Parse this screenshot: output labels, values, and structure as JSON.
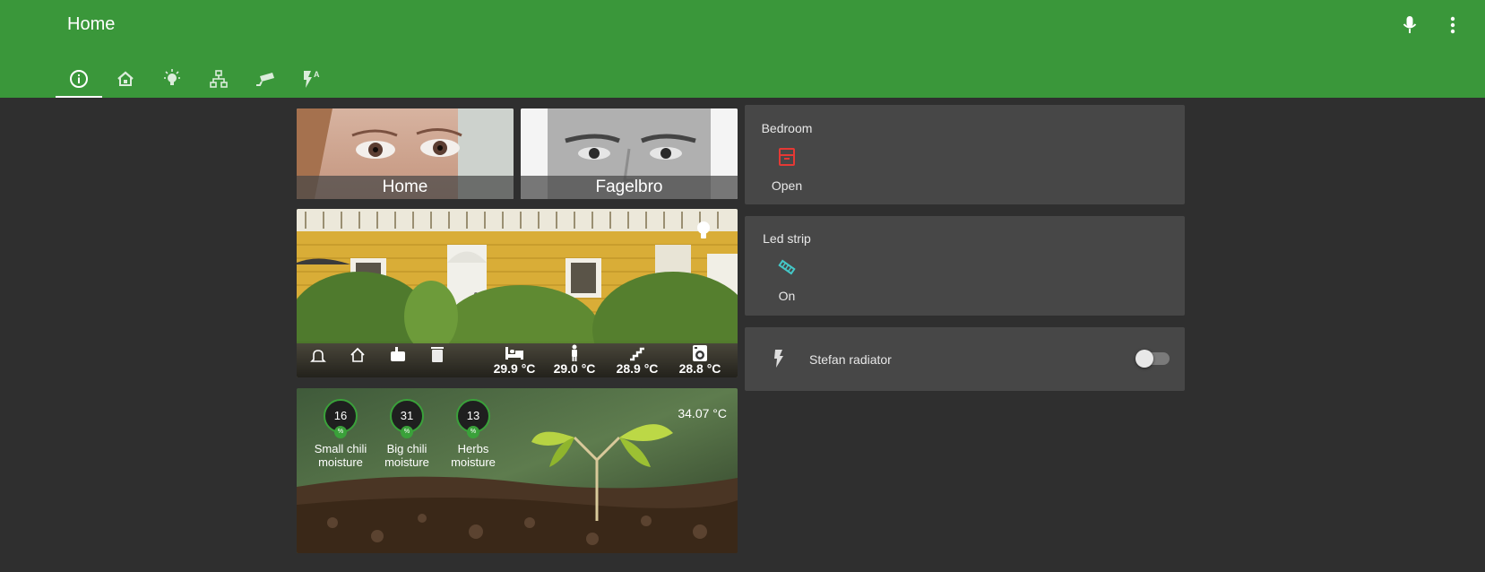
{
  "app": {
    "title": "Home",
    "actions": [
      {
        "name": "microphone-icon"
      },
      {
        "name": "more-vertical-icon"
      }
    ]
  },
  "tabs": [
    {
      "id": "info",
      "icon": "info-icon",
      "active": true
    },
    {
      "id": "home",
      "icon": "home-icon",
      "active": false
    },
    {
      "id": "lights",
      "icon": "lightbulb-icon",
      "active": false
    },
    {
      "id": "network",
      "icon": "network-icon",
      "active": false
    },
    {
      "id": "camera",
      "icon": "camera-icon",
      "active": false
    },
    {
      "id": "automation",
      "icon": "flash-auto-icon",
      "active": false
    }
  ],
  "people": [
    {
      "name": "Home"
    },
    {
      "name": "Fagelbro"
    }
  ],
  "house": {
    "status_icons": [
      "bell-icon",
      "home-icon",
      "mailbox-icon",
      "trash-icon"
    ],
    "temperatures": [
      {
        "icon": "bed-icon",
        "value": "29.9 °C"
      },
      {
        "icon": "person-icon",
        "value": "29.0 °C"
      },
      {
        "icon": "stairs-icon",
        "value": "28.9 °C"
      },
      {
        "icon": "washing-machine-icon",
        "value": "28.8 °C"
      }
    ],
    "light_icon": "lightbulb-icon"
  },
  "plants": {
    "sensors": [
      {
        "value": "16",
        "line1": "Small chili",
        "line2": "moisture",
        "badge": "%"
      },
      {
        "value": "31",
        "line1": "Big chili",
        "line2": "moisture",
        "badge": "%"
      },
      {
        "value": "13",
        "line1": "Herbs",
        "line2": "moisture",
        "badge": "%"
      }
    ],
    "temperature": "34.07 °C"
  },
  "entities": {
    "bedroom": {
      "name": "Bedroom",
      "state": "Open",
      "icon": "window-open-icon",
      "color": "#e53935"
    },
    "led_strip": {
      "name": "Led strip",
      "state": "On",
      "icon": "led-strip-icon",
      "color": "#44c7c7"
    },
    "radiator": {
      "name": "Stefan radiator",
      "icon": "flash-icon",
      "on": false
    }
  }
}
